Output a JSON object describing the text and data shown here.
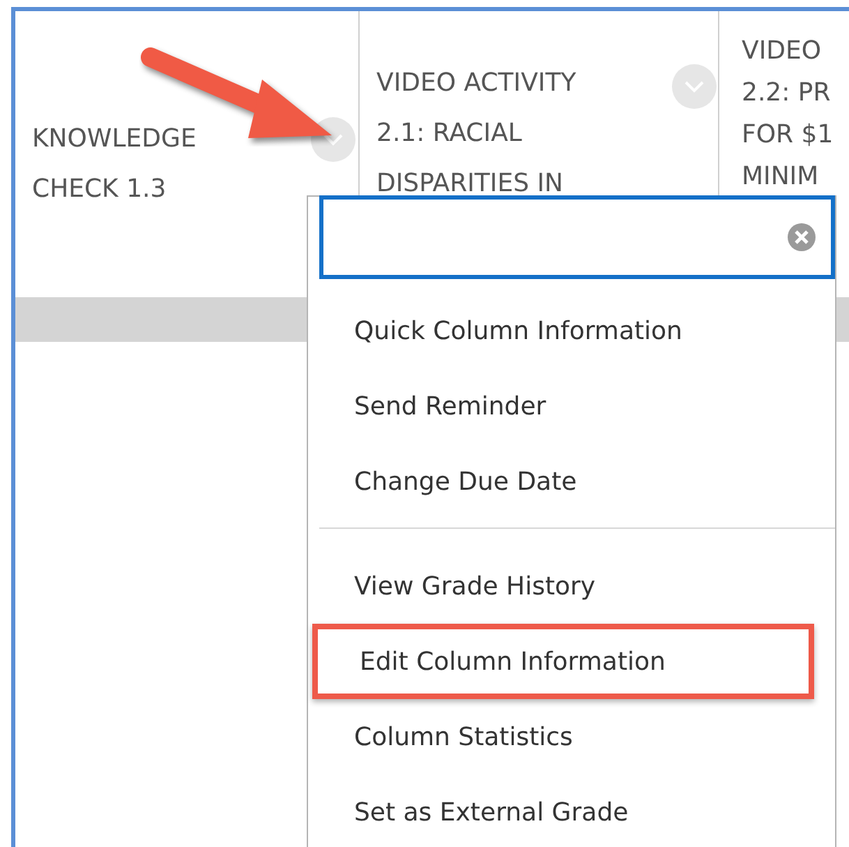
{
  "columns": [
    {
      "lines": [
        "KNOWLEDGE",
        "CHECK 1.3"
      ],
      "has_menu_button": true
    },
    {
      "lines": [
        "VIDEO ACTIVITY",
        "2.1: RACIAL",
        "DISPARITIES IN"
      ],
      "has_menu_button": true
    },
    {
      "lines": [
        "VIDEO",
        "2.2: PR",
        "FOR $1",
        "MINIM"
      ],
      "has_menu_button": false
    }
  ],
  "menu": {
    "groups": [
      {
        "items": [
          {
            "label": "Quick Column Information",
            "highlighted": false
          },
          {
            "label": "Send Reminder",
            "highlighted": false
          },
          {
            "label": "Change Due Date",
            "highlighted": false
          }
        ]
      },
      {
        "items": [
          {
            "label": "View Grade History",
            "highlighted": false
          },
          {
            "label": "Edit Column Information",
            "highlighted": true
          },
          {
            "label": "Column Statistics",
            "highlighted": false
          },
          {
            "label": "Set as External Grade",
            "highlighted": false
          }
        ]
      }
    ]
  },
  "annotation": {
    "kind": "arrow"
  }
}
